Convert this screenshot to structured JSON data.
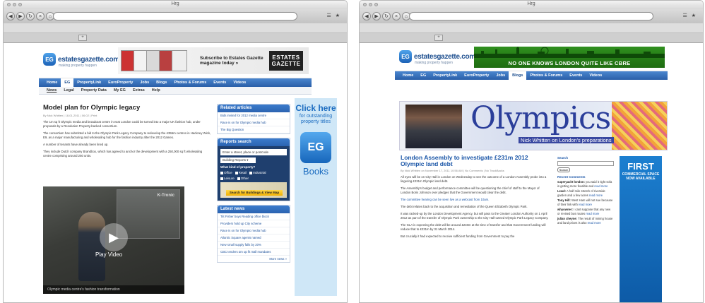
{
  "windows": [
    {
      "title": "Hrg",
      "site": {
        "logo_text": "estatesgazette.com",
        "logo_badge": "EG",
        "logo_tag": "making property happen",
        "nav": [
          "Home",
          "EG",
          "PropertyLink",
          "EuroProperty",
          "Jobs",
          "Blogs",
          "Photos & Forums",
          "Events",
          "Videos"
        ],
        "subnav": [
          "News",
          "Legal",
          "Property Data",
          "My EG",
          "Extras",
          "Help"
        ],
        "ad_text": "Subscribe to Estates Gazette magazine today »",
        "ad_brand": "ESTATES GAZETTE",
        "article": {
          "title": "Model plan for Olympic legacy",
          "meta": "By Nick Whitten | 18-01-2011 | 06:02 | Print",
          "paragraphs": [
            "The 1m sq ft Olympic media and broadcast centre in east London could be turned into a major UK fashion hub, under proposals by a Resolution Property-backed consortium.",
            "The consortium has submitted a bid to the Olympic Park Legacy Company to redevelop the £355m centres in Hackney Wick, E9, as a major manufacturing and wholesaling hub for the fashion industry after the 2012 Games.",
            "A number of tenants have already been lined up.",
            "They include Dutch company Brandbox, which has agreed to anchor the development with a 250,000 sq ft wholesaling centre comprising around 250 units."
          ],
          "video_play": "Play Video",
          "video_caption": "Olympic media centre's fashion transformation",
          "video_sign": "K-Tronic"
        },
        "related": {
          "heading": "Related articles",
          "links": [
            "Bids invited for 2012 media centre",
            "Race is on for Olympic media hub",
            "The Big Question"
          ]
        },
        "reports": {
          "heading": "Reports search",
          "input_placeholder": "Enter a street, place or postcode",
          "select_value": "Building Reports",
          "question": "What kind of property?",
          "options": [
            "Office",
            "Retail",
            "Industrial",
            "Leisure",
            "Other"
          ],
          "map_button": "Search for Buildings & View Map"
        },
        "latest": {
          "heading": "Latest news",
          "links": [
            "Tiit Fisher buys Reading office block",
            "Providers hold up City scheme",
            "Race is on for Olympic media hub",
            "Atlantic Square agents named",
            "New small supply falls by 20%",
            "CBC tenders £m up fit mall mandates"
          ],
          "more": "More news »"
        },
        "sky_ad": {
          "click": "Click here",
          "sub": "for outstanding property titles",
          "badge": "EG",
          "books": "Books"
        }
      }
    },
    {
      "title": "Hrg",
      "site": {
        "logo_text": "estatesgazette.com",
        "logo_badge": "EG",
        "logo_tag": "making property happen",
        "nav": [
          "Home",
          "EG",
          "PropertyLink",
          "EuroProperty",
          "Jobs",
          "Blogs",
          "Photos & Forums",
          "Events",
          "Videos"
        ],
        "banner_text": "NO ONE KNOWS LONDON QUITE LIKE CBRE",
        "olympics": {
          "title": "Olympics",
          "subtitle": "Nick Whitten on London's preparations"
        },
        "post": {
          "title": "London Assembly to investigate £231m 2012 Olympic land debt",
          "meta": "By Nick Whitten on November 17, 2011 10:56 AM | No Comments | No TrackBacks",
          "paragraphs": [
            "All eyes will be on City Hall in London on Wednesday to see the outcome of a London Assembly probe into a lingering £231m Olympic land debt.",
            "The Assembly's budget and performance committee will be questioning the chief of staff to the Mayor of London Boris Johnson over pledges that the Government would clear the debt.",
            "The committee hearing can be seen live as a webcast from 10am.",
            "The debt relates back to the acquisition and remediation of the Queen Elizabeth Olympic Park.",
            "It was racked-up by the London Development Agency, but will pass to the Greater London Authority on 1 April 2012 as part of the transfer of Olympic Park ownership to the City Hall-owned Olympic Park Legacy Company.",
            "The GLA is expecting the debt will be around £240m at the time of transfer and that Government funding will reduce that to £231m by 31 March 2014.",
            "But crucially it had expected to receive sufficient funding from Government to pay the"
          ]
        },
        "blog_side": {
          "search_label": "Search",
          "search_button": "Search",
          "recent_label": "Recent Comments",
          "comments": [
            {
              "author": "superyacht london:",
              "text": "you said it right sofa is getting more feasible and",
              "more": "read more"
            },
            {
              "author": "Lewd:",
              "text": "A half mile stretch of riverside garden and a few acres",
              "more": "read more"
            },
            {
              "author": "Tony Hill:",
              "text": "West Ham will not sue because of their link with",
              "more": "read more"
            },
            {
              "author": "whyowner:",
              "text": "I cant suppose that any new or revised bus routes",
              "more": "read more"
            },
            {
              "author": "julian cheyne:",
              "text": "The result of mining house and land prices is also",
              "more": "read more"
            }
          ]
        },
        "first_ad": {
          "big": "FIRST",
          "small": "COMMERCIAL SPACE NOW AVAILABLE"
        }
      }
    }
  ],
  "colors": {
    "nav_blue": "#2a5fa8",
    "link_blue": "#1c57a8",
    "cbre_green": "#1f6d12"
  }
}
